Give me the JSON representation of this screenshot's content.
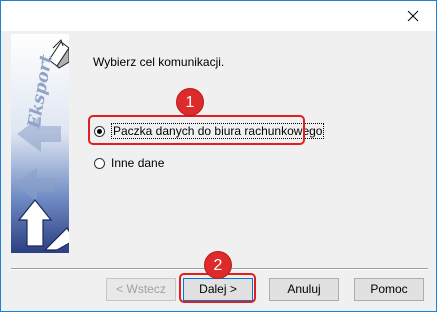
{
  "window": {
    "close_label": "×"
  },
  "sidebar": {
    "brand_text": "Eksport"
  },
  "main": {
    "prompt": "Wybierz cel komunikacji.",
    "options": [
      {
        "label": "Paczka danych do biura rachunkowego",
        "checked": true
      },
      {
        "label": "Inne dane",
        "checked": false
      }
    ]
  },
  "annotations": {
    "badge1": "1",
    "badge2": "2"
  },
  "footer": {
    "back_label": "< Wstecz",
    "next_label": "Dalej >",
    "cancel_label": "Anuluj",
    "help_label": "Pomoc"
  },
  "colors": {
    "annotation": "#e02020",
    "window_border": "#1883d7",
    "panel_blue": "#3d5a9c"
  }
}
